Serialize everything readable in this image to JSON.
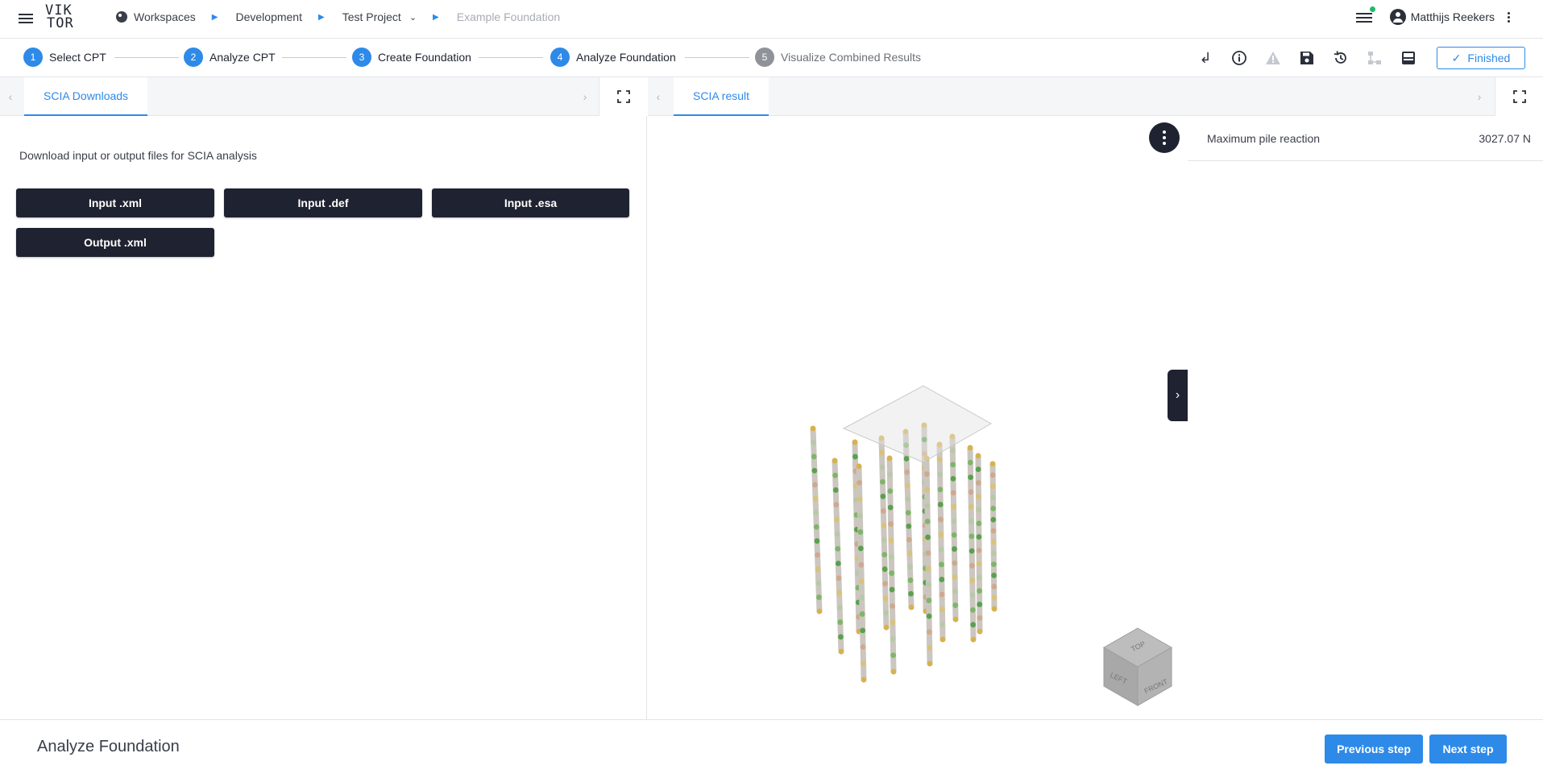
{
  "app": {
    "logo_line1": "VIK",
    "logo_line2": "TOR"
  },
  "breadcrumb": {
    "items": [
      {
        "label": "Workspaces"
      },
      {
        "label": "Development"
      },
      {
        "label": "Test Project"
      },
      {
        "label": "Example Foundation"
      }
    ]
  },
  "user": {
    "name": "Matthijs Reekers"
  },
  "steps": [
    {
      "number": "1",
      "label": "Select CPT"
    },
    {
      "number": "2",
      "label": "Analyze CPT"
    },
    {
      "number": "3",
      "label": "Create Foundation"
    },
    {
      "number": "4",
      "label": "Analyze Foundation"
    },
    {
      "number": "5",
      "label": "Visualize Combined Results"
    }
  ],
  "toolbar": {
    "finished_label": "Finished"
  },
  "left_panel": {
    "tab_label": "SCIA Downloads",
    "description": "Download input or output files for SCIA analysis",
    "buttons": [
      "Input .xml",
      "Input .def",
      "Input .esa",
      "Output .xml"
    ]
  },
  "mid_panel": {
    "tab_label": "SCIA result",
    "cube_labels": {
      "top": "TOP",
      "left": "LEFT",
      "front": "FRONT"
    }
  },
  "right_panel": {
    "rows": [
      {
        "label": "Maximum pile reaction",
        "value": "3027.07 N"
      }
    ]
  },
  "footer": {
    "title": "Analyze Foundation",
    "prev_label": "Previous step",
    "next_label": "Next step"
  },
  "colors": {
    "accent": "#2d8ae8",
    "dark": "#1f2230",
    "success": "#1fba6a"
  }
}
